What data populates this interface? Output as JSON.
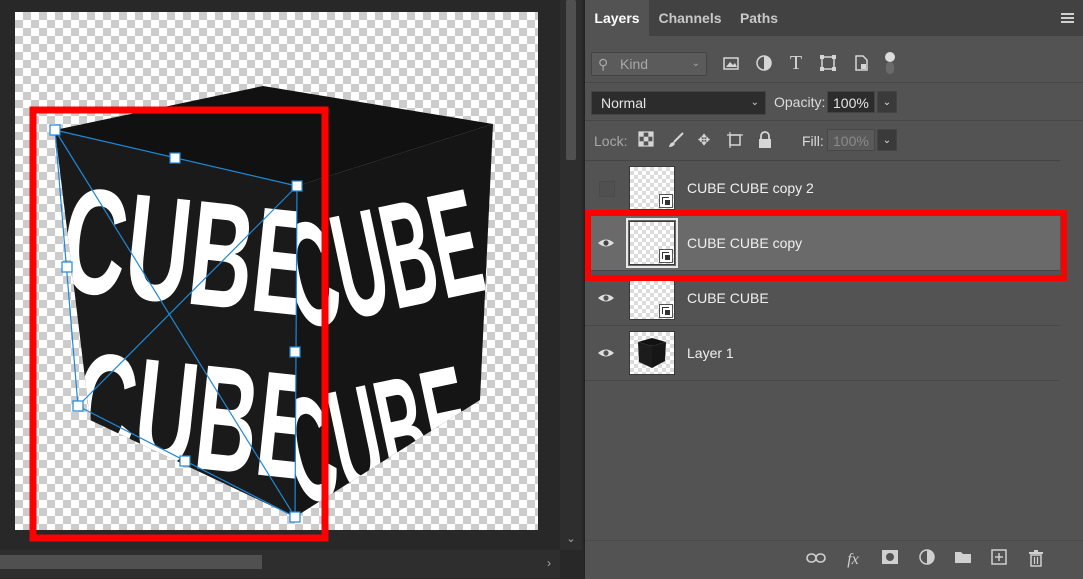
{
  "canvas": {
    "text_rows": [
      "CUBE",
      "CUBE"
    ],
    "colors": {
      "selection_highlight": "#ff0000",
      "transform_handles": "#1e88d8",
      "cube_face": "#1a1a1a"
    }
  },
  "panel": {
    "tabs": [
      {
        "label": "Layers",
        "active": true
      },
      {
        "label": "Channels",
        "active": false
      },
      {
        "label": "Paths",
        "active": false
      }
    ],
    "filter": {
      "kind_label": "Kind",
      "icons": [
        "image-filter-icon",
        "adjustment-filter-icon",
        "type-filter-icon",
        "shape-filter-icon",
        "smart-object-filter-icon"
      ]
    },
    "blend_mode": "Normal",
    "opacity_label": "Opacity:",
    "opacity_value": "100%",
    "lock_label": "Lock:",
    "fill_label": "Fill:",
    "fill_value": "100%",
    "layers": [
      {
        "name": "CUBE CUBE copy 2",
        "visible": false,
        "selected": false,
        "type": "smart-object"
      },
      {
        "name": "CUBE CUBE copy",
        "visible": true,
        "selected": true,
        "type": "smart-object"
      },
      {
        "name": "CUBE CUBE",
        "visible": true,
        "selected": false,
        "type": "smart-object"
      },
      {
        "name": "Layer 1",
        "visible": true,
        "selected": false,
        "type": "pixel"
      }
    ]
  }
}
